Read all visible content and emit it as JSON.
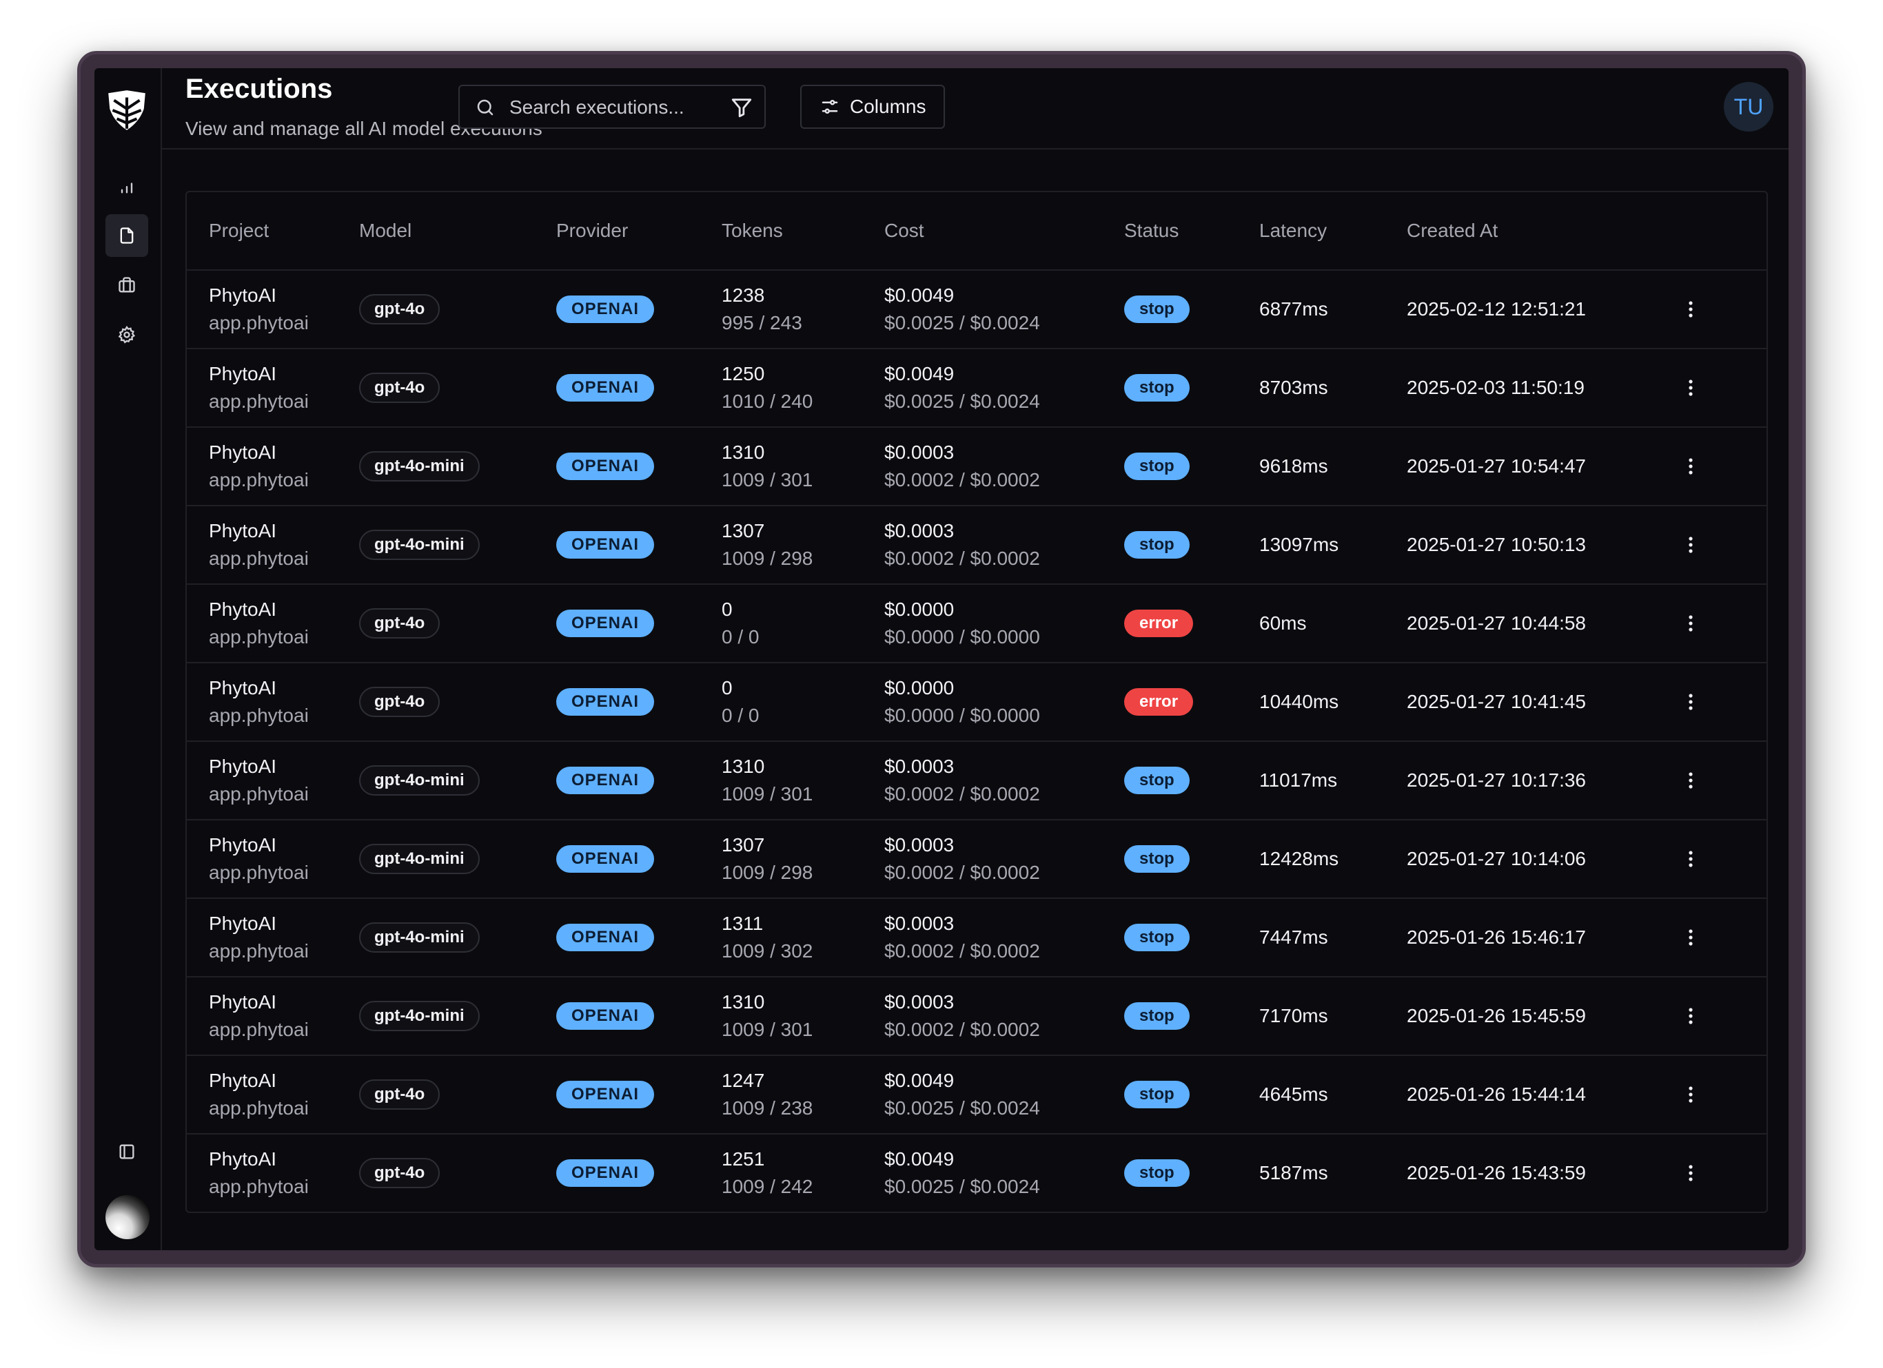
{
  "header": {
    "title": "Executions",
    "subtitle": "View and manage all AI model executions",
    "search_placeholder": "Search executions...",
    "columns_label": "Columns",
    "user_initials": "TU"
  },
  "colors": {
    "accent": "#5fb0ff",
    "error": "#ef4444",
    "background": "#0b0b0f"
  },
  "sidebar": {
    "items": [
      {
        "icon": "bar-chart-icon",
        "active": false
      },
      {
        "icon": "file-icon",
        "active": true
      },
      {
        "icon": "briefcase-icon",
        "active": false
      },
      {
        "icon": "gear-icon",
        "active": false
      }
    ],
    "bottom": [
      {
        "icon": "panel-toggle-icon"
      }
    ]
  },
  "table": {
    "columns": [
      "Project",
      "Model",
      "Provider",
      "Tokens",
      "Cost",
      "Status",
      "Latency",
      "Created At"
    ],
    "rows": [
      {
        "project": "PhytoAI",
        "project_id": "app.phytoai",
        "model": "gpt-4o",
        "provider": "OPENAI",
        "tokens_total": "1238",
        "tokens_split": "995 / 243",
        "cost_total": "$0.0049",
        "cost_split": "$0.0025 / $0.0024",
        "status": "stop",
        "latency": "6877ms",
        "created_at": "2025-02-12 12:51:21"
      },
      {
        "project": "PhytoAI",
        "project_id": "app.phytoai",
        "model": "gpt-4o",
        "provider": "OPENAI",
        "tokens_total": "1250",
        "tokens_split": "1010 / 240",
        "cost_total": "$0.0049",
        "cost_split": "$0.0025 / $0.0024",
        "status": "stop",
        "latency": "8703ms",
        "created_at": "2025-02-03 11:50:19"
      },
      {
        "project": "PhytoAI",
        "project_id": "app.phytoai",
        "model": "gpt-4o-mini",
        "provider": "OPENAI",
        "tokens_total": "1310",
        "tokens_split": "1009 / 301",
        "cost_total": "$0.0003",
        "cost_split": "$0.0002 / $0.0002",
        "status": "stop",
        "latency": "9618ms",
        "created_at": "2025-01-27 10:54:47"
      },
      {
        "project": "PhytoAI",
        "project_id": "app.phytoai",
        "model": "gpt-4o-mini",
        "provider": "OPENAI",
        "tokens_total": "1307",
        "tokens_split": "1009 / 298",
        "cost_total": "$0.0003",
        "cost_split": "$0.0002 / $0.0002",
        "status": "stop",
        "latency": "13097ms",
        "created_at": "2025-01-27 10:50:13"
      },
      {
        "project": "PhytoAI",
        "project_id": "app.phytoai",
        "model": "gpt-4o",
        "provider": "OPENAI",
        "tokens_total": "0",
        "tokens_split": "0 / 0",
        "cost_total": "$0.0000",
        "cost_split": "$0.0000 / $0.0000",
        "status": "error",
        "latency": "60ms",
        "created_at": "2025-01-27 10:44:58"
      },
      {
        "project": "PhytoAI",
        "project_id": "app.phytoai",
        "model": "gpt-4o",
        "provider": "OPENAI",
        "tokens_total": "0",
        "tokens_split": "0 / 0",
        "cost_total": "$0.0000",
        "cost_split": "$0.0000 / $0.0000",
        "status": "error",
        "latency": "10440ms",
        "created_at": "2025-01-27 10:41:45"
      },
      {
        "project": "PhytoAI",
        "project_id": "app.phytoai",
        "model": "gpt-4o-mini",
        "provider": "OPENAI",
        "tokens_total": "1310",
        "tokens_split": "1009 / 301",
        "cost_total": "$0.0003",
        "cost_split": "$0.0002 / $0.0002",
        "status": "stop",
        "latency": "11017ms",
        "created_at": "2025-01-27 10:17:36"
      },
      {
        "project": "PhytoAI",
        "project_id": "app.phytoai",
        "model": "gpt-4o-mini",
        "provider": "OPENAI",
        "tokens_total": "1307",
        "tokens_split": "1009 / 298",
        "cost_total": "$0.0003",
        "cost_split": "$0.0002 / $0.0002",
        "status": "stop",
        "latency": "12428ms",
        "created_at": "2025-01-27 10:14:06"
      },
      {
        "project": "PhytoAI",
        "project_id": "app.phytoai",
        "model": "gpt-4o-mini",
        "provider": "OPENAI",
        "tokens_total": "1311",
        "tokens_split": "1009 / 302",
        "cost_total": "$0.0003",
        "cost_split": "$0.0002 / $0.0002",
        "status": "stop",
        "latency": "7447ms",
        "created_at": "2025-01-26 15:46:17"
      },
      {
        "project": "PhytoAI",
        "project_id": "app.phytoai",
        "model": "gpt-4o-mini",
        "provider": "OPENAI",
        "tokens_total": "1310",
        "tokens_split": "1009 / 301",
        "cost_total": "$0.0003",
        "cost_split": "$0.0002 / $0.0002",
        "status": "stop",
        "latency": "7170ms",
        "created_at": "2025-01-26 15:45:59"
      },
      {
        "project": "PhytoAI",
        "project_id": "app.phytoai",
        "model": "gpt-4o",
        "provider": "OPENAI",
        "tokens_total": "1247",
        "tokens_split": "1009 / 238",
        "cost_total": "$0.0049",
        "cost_split": "$0.0025 / $0.0024",
        "status": "stop",
        "latency": "4645ms",
        "created_at": "2025-01-26 15:44:14"
      },
      {
        "project": "PhytoAI",
        "project_id": "app.phytoai",
        "model": "gpt-4o",
        "provider": "OPENAI",
        "tokens_total": "1251",
        "tokens_split": "1009 / 242",
        "cost_total": "$0.0049",
        "cost_split": "$0.0025 / $0.0024",
        "status": "stop",
        "latency": "5187ms",
        "created_at": "2025-01-26 15:43:59"
      }
    ]
  }
}
